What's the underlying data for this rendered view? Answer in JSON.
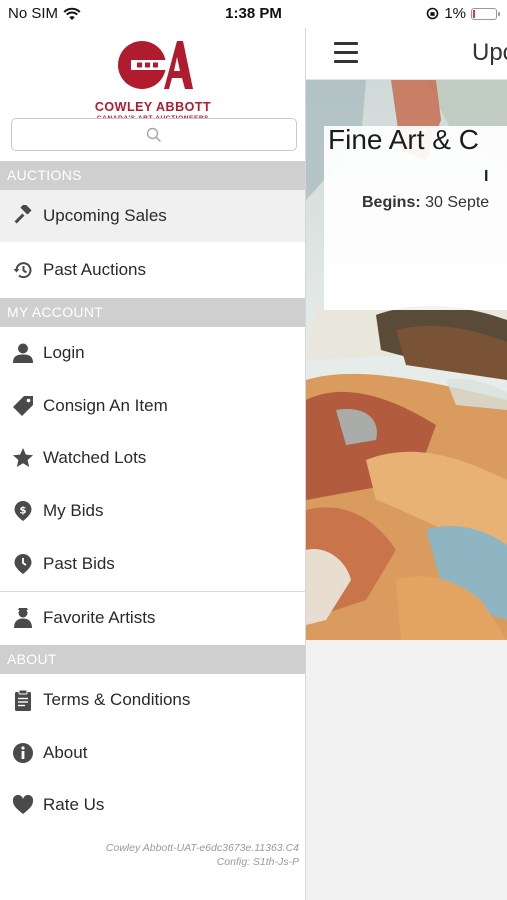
{
  "status_bar": {
    "carrier": "No SIM",
    "time": "1:38 PM",
    "battery_percent": "1%",
    "battery_level": 0.01
  },
  "brand": {
    "name": "COWLEY ABBOTT",
    "tagline": "CANADA'S ART AUCTIONEERS",
    "color": "#b01c2e"
  },
  "search": {
    "placeholder": "",
    "value": ""
  },
  "menu": {
    "auctions_header": "AUCTIONS",
    "upcoming_sales": "Upcoming Sales",
    "past_auctions": "Past Auctions",
    "account_header": "MY ACCOUNT",
    "login": "Login",
    "consign": "Consign An Item",
    "watched_lots": "Watched Lots",
    "my_bids": "My Bids",
    "past_bids": "Past Bids",
    "favorite_artists": "Favorite Artists",
    "about_header": "ABOUT",
    "terms": "Terms & Conditions",
    "about": "About",
    "rate_us": "Rate Us"
  },
  "icons": {
    "upcoming_sales": "gavel-icon",
    "past_auctions": "history-icon",
    "login": "person-icon",
    "consign": "tag-icon",
    "watched_lots": "star-icon",
    "my_bids": "dollar-pin-icon",
    "past_bids": "clock-pin-icon",
    "favorite_artists": "artist-icon",
    "terms": "clipboard-icon",
    "about": "info-icon",
    "rate_us": "heart-icon"
  },
  "footer": {
    "version": "Cowley Abbott-UAT-e6dc3673e.11363.C4",
    "config": "Config: S1th-Js-P"
  },
  "main": {
    "title": "Upco",
    "hero_title": "Fine Art & C",
    "hero_subtitle": "I",
    "begins_label": "Begins:",
    "begins_value": "30 Septe"
  },
  "colors": {
    "section_header_bg": "#cfcfcf",
    "active_row_bg": "#f0f0f0",
    "icon": "#4a4a4a"
  }
}
